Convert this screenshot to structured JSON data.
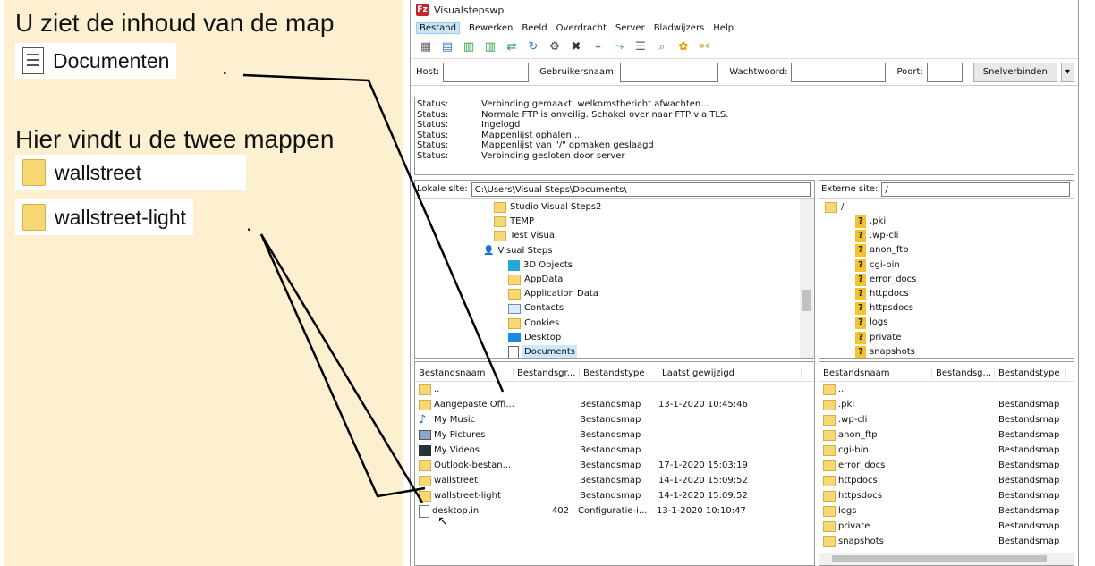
{
  "instructions": {
    "line1": "U ziet de inhoud van de map",
    "chip1": "Documenten",
    "period1": ".",
    "line2": "Hier vindt u de twee mappen",
    "chip2": "wallstreet",
    "chip3": "wallstreet-light",
    "period2": "."
  },
  "window": {
    "title": "Visualstepswp"
  },
  "menu": [
    "Bestand",
    "Bewerken",
    "Beeld",
    "Overdracht",
    "Server",
    "Bladwijzers",
    "Help"
  ],
  "quickconnect": {
    "host_label": "Host:",
    "user_label": "Gebruikersnaam:",
    "pass_label": "Wachtwoord:",
    "port_label": "Poort:",
    "button": "Snelverbinden",
    "dropdown": "▾"
  },
  "log": [
    {
      "k": "Status:",
      "v": "Verbinding gemaakt, welkomstbericht afwachten..."
    },
    {
      "k": "Status:",
      "v": "Normale FTP is onveilig. Schakel over naar FTP via TLS."
    },
    {
      "k": "Status:",
      "v": "Ingelogd"
    },
    {
      "k": "Status:",
      "v": "Mappenlijst ophalen..."
    },
    {
      "k": "Status:",
      "v": "Mappenlijst van \"/\" opmaken geslaagd"
    },
    {
      "k": "Status:",
      "v": "Verbinding gesloten door server"
    }
  ],
  "local": {
    "label": "Lokale site:",
    "path": "C:\\Users\\Visual Steps\\Documents\\",
    "tree": [
      "Studio Visual Steps2",
      "TEMP",
      "Test Visual",
      "Visual Steps",
      "3D Objects",
      "AppData",
      "Application Data",
      "Contacts",
      "Cookies",
      "Desktop",
      "Documents"
    ],
    "headers": [
      "Bestandsnaam",
      "Bestandsgr...",
      "Bestandstype",
      "Laatst gewijzigd"
    ],
    "files": [
      {
        "name": "..",
        "size": "",
        "type": "",
        "date": ""
      },
      {
        "name": "Aangepaste Offi...",
        "size": "",
        "type": "Bestandsmap",
        "date": "13-1-2020 10:45:46"
      },
      {
        "name": "My Music",
        "size": "",
        "type": "Bestandsmap",
        "date": ""
      },
      {
        "name": "My Pictures",
        "size": "",
        "type": "Bestandsmap",
        "date": ""
      },
      {
        "name": "My Videos",
        "size": "",
        "type": "Bestandsmap",
        "date": ""
      },
      {
        "name": "Outlook-bestan...",
        "size": "",
        "type": "Bestandsmap",
        "date": "17-1-2020 15:03:19"
      },
      {
        "name": "wallstreet",
        "size": "",
        "type": "Bestandsmap",
        "date": "14-1-2020 15:09:52"
      },
      {
        "name": "wallstreet-light",
        "size": "",
        "type": "Bestandsmap",
        "date": "14-1-2020 15:09:52"
      },
      {
        "name": "desktop.ini",
        "size": "402",
        "type": "Configuratie-i...",
        "date": "13-1-2020 10:10:47"
      }
    ]
  },
  "remote": {
    "label": "Externe site:",
    "path": "/",
    "root": "/",
    "tree": [
      ".pki",
      ".wp-cli",
      "anon_ftp",
      "cgi-bin",
      "error_docs",
      "httpdocs",
      "httpsdocs",
      "logs",
      "private",
      "snapshots"
    ],
    "headers": [
      "Bestandsnaam",
      "Bestandsg...",
      "Bestandstype"
    ],
    "files": [
      {
        "name": "..",
        "type": ""
      },
      {
        "name": ".pki",
        "type": "Bestandsmap"
      },
      {
        "name": ".wp-cli",
        "type": "Bestandsmap"
      },
      {
        "name": "anon_ftp",
        "type": "Bestandsmap"
      },
      {
        "name": "cgi-bin",
        "type": "Bestandsmap"
      },
      {
        "name": "error_docs",
        "type": "Bestandsmap"
      },
      {
        "name": "httpdocs",
        "type": "Bestandsmap"
      },
      {
        "name": "httpsdocs",
        "type": "Bestandsmap"
      },
      {
        "name": "logs",
        "type": "Bestandsmap"
      },
      {
        "name": "private",
        "type": "Bestandsmap"
      },
      {
        "name": "snapshots",
        "type": "Bestandsmap"
      }
    ]
  }
}
